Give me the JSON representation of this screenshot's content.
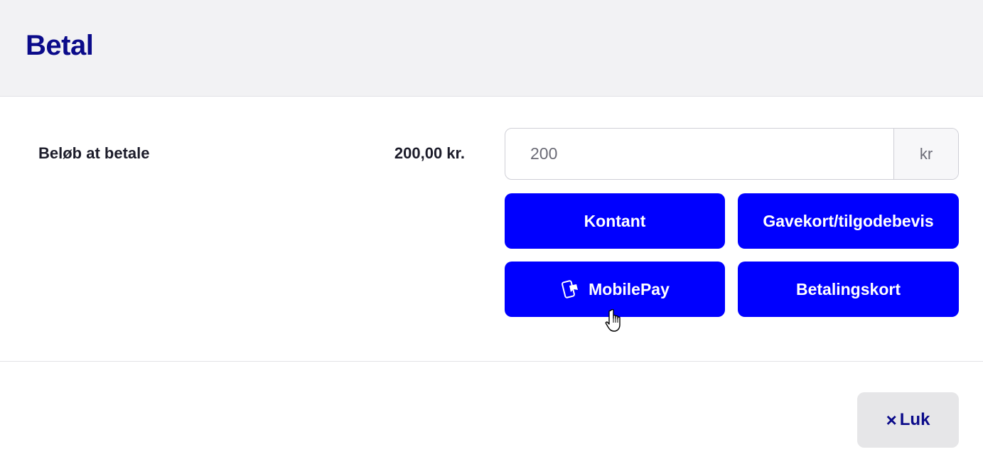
{
  "header": {
    "title": "Betal"
  },
  "payment": {
    "label": "Beløb at betale",
    "amount_due": "200,00 kr.",
    "input": {
      "value": "",
      "placeholder": "200",
      "suffix": "kr"
    }
  },
  "methods": {
    "cash": "Kontant",
    "giftcard": "Gavekort/tilgodebevis",
    "mobilepay": "MobilePay",
    "card": "Betalingskort"
  },
  "footer": {
    "close_icon": "×",
    "close_label": "Luk"
  },
  "icons": {
    "mobilepay": "mobilepay-icon",
    "close": "close-icon",
    "cursor": "hand-pointer-icon"
  },
  "colors": {
    "primary": "#0000ff",
    "title": "#0b0b8a",
    "header_bg": "#f2f2f4",
    "close_bg": "#e6e6e8"
  }
}
